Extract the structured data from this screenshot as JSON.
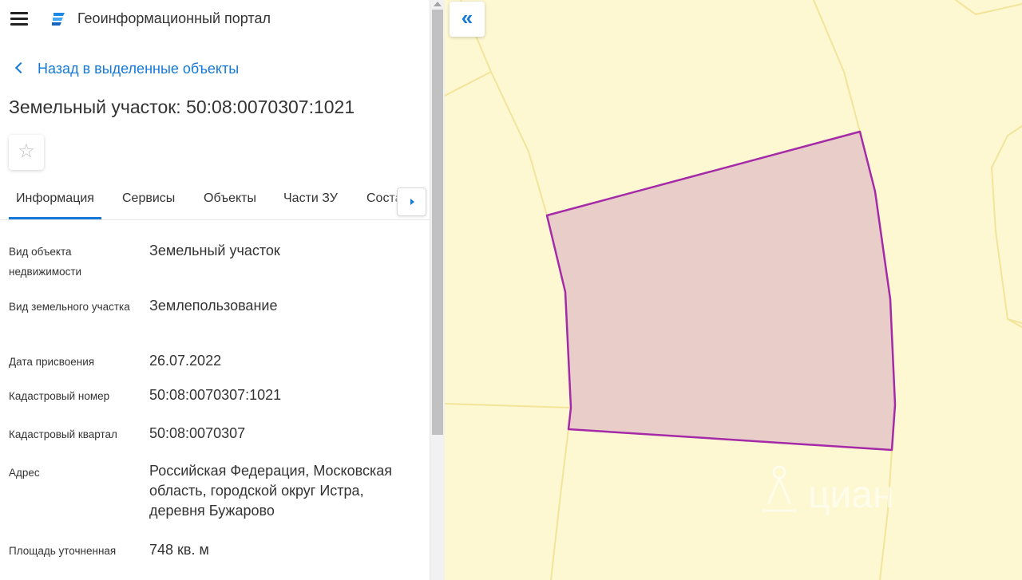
{
  "header": {
    "title": "Геоинформационный портал",
    "menu_icon": "hamburger-menu-icon",
    "logo_icon": "portal-logo-icon"
  },
  "nav": {
    "back_label": "Назад в выделенные объекты"
  },
  "object": {
    "title": "Земельный участок: 50:08:0070307:1021"
  },
  "tabs": [
    {
      "label": "Информация",
      "active": true
    },
    {
      "label": "Сервисы"
    },
    {
      "label": "Объекты"
    },
    {
      "label": "Части ЗУ"
    },
    {
      "label": "Соста"
    }
  ],
  "info_rows": [
    {
      "label": "Вид объекта недвижимости",
      "value": "Земельный участок"
    },
    {
      "label": "Вид земельного участка",
      "value": "Землепользование"
    },
    {
      "label": "Дата присвоения",
      "value": "26.07.2022"
    },
    {
      "label": "Кадастровый номер",
      "value": "50:08:0070307:1021"
    },
    {
      "label": "Кадастровый квартал",
      "value": "50:08:0070307"
    },
    {
      "label": "Адрес",
      "value": "Российская Федерация, Московская область, городской округ Истра, деревня Бужарово"
    },
    {
      "label": "Площадь уточненная",
      "value": "748 кв. м"
    }
  ],
  "map": {
    "watermark": "циан",
    "colors": {
      "background": "#fdf8d1",
      "parcel_border": "#f2e49a",
      "selected_fill": "#e9cdc9",
      "selected_stroke": "#a42aa8"
    }
  },
  "colors": {
    "accent": "#1479d9"
  }
}
